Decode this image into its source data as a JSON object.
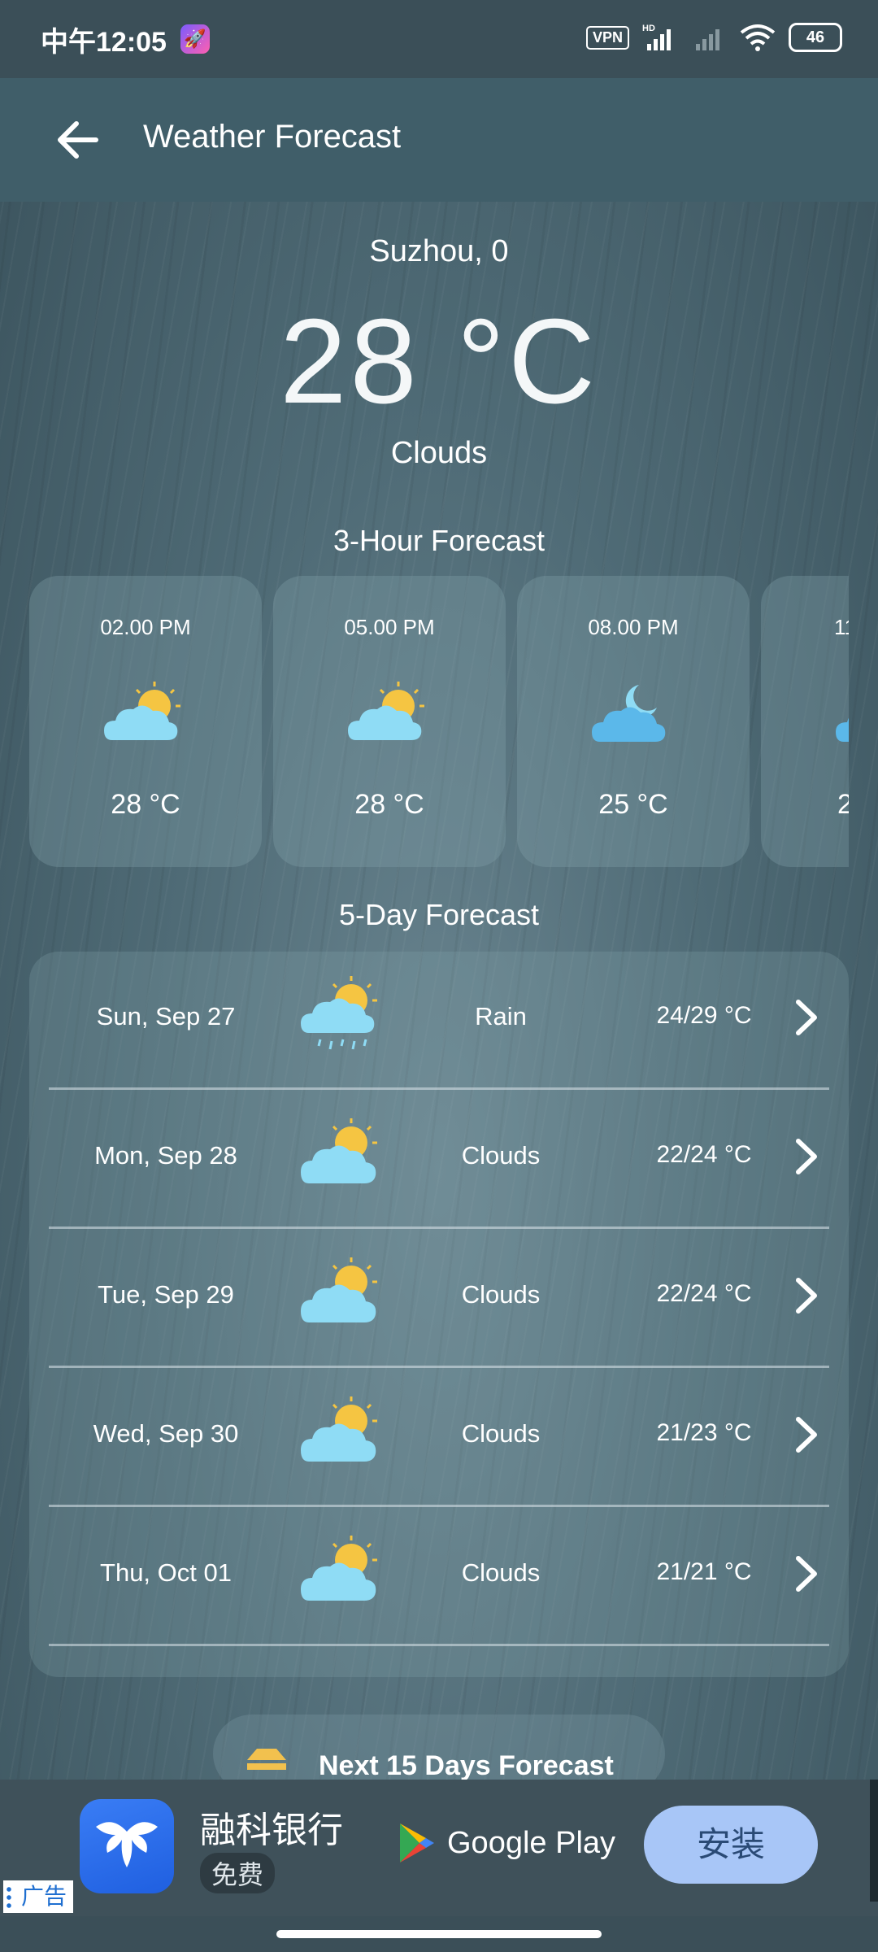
{
  "status_bar": {
    "time": "中午12:05",
    "vpn": "VPN",
    "hd": "HD",
    "battery": "46"
  },
  "app_bar": {
    "title": "Weather Forecast"
  },
  "current": {
    "city": "Suzhou, 0",
    "temperature": "28 °C",
    "condition": "Clouds"
  },
  "hourly": {
    "title": "3-Hour Forecast",
    "items": [
      {
        "time": "02.00 PM",
        "icon": "sun-cloud-icon",
        "temp": "28 °C"
      },
      {
        "time": "05.00 PM",
        "icon": "sun-cloud-icon",
        "temp": "28 °C"
      },
      {
        "time": "08.00 PM",
        "icon": "moon-cloud-icon",
        "temp": "25 °C"
      },
      {
        "time": "11",
        "icon": "moon-cloud-icon",
        "temp": "2"
      }
    ]
  },
  "daily": {
    "title": "5-Day Forecast",
    "items": [
      {
        "day": "Sun, Sep 27",
        "icon": "rain-sun-cloud-icon",
        "condition": "Rain",
        "temp": "24/29 °C"
      },
      {
        "day": "Mon, Sep 28",
        "icon": "sun-cloud-icon",
        "condition": "Clouds",
        "temp": "22/24 °C"
      },
      {
        "day": "Tue, Sep 29",
        "icon": "sun-cloud-icon",
        "condition": "Clouds",
        "temp": "22/24 °C"
      },
      {
        "day": "Wed, Sep 30",
        "icon": "sun-cloud-icon",
        "condition": "Clouds",
        "temp": "21/23 °C"
      },
      {
        "day": "Thu, Oct 01",
        "icon": "sun-cloud-icon",
        "condition": "Clouds",
        "temp": "21/21 °C"
      }
    ]
  },
  "more_button": {
    "label": "Next 15 Days Forecast"
  },
  "ad": {
    "app_name": "融科银行",
    "free_label": "免费",
    "store": "Google Play",
    "install_label": "安装",
    "ad_tag": "广告"
  },
  "colors": {
    "sun": "#f5c542",
    "cloud": "#8fdcf5",
    "moon_cloud": "#5bb8ea",
    "install_button": "#a8c6f7"
  }
}
